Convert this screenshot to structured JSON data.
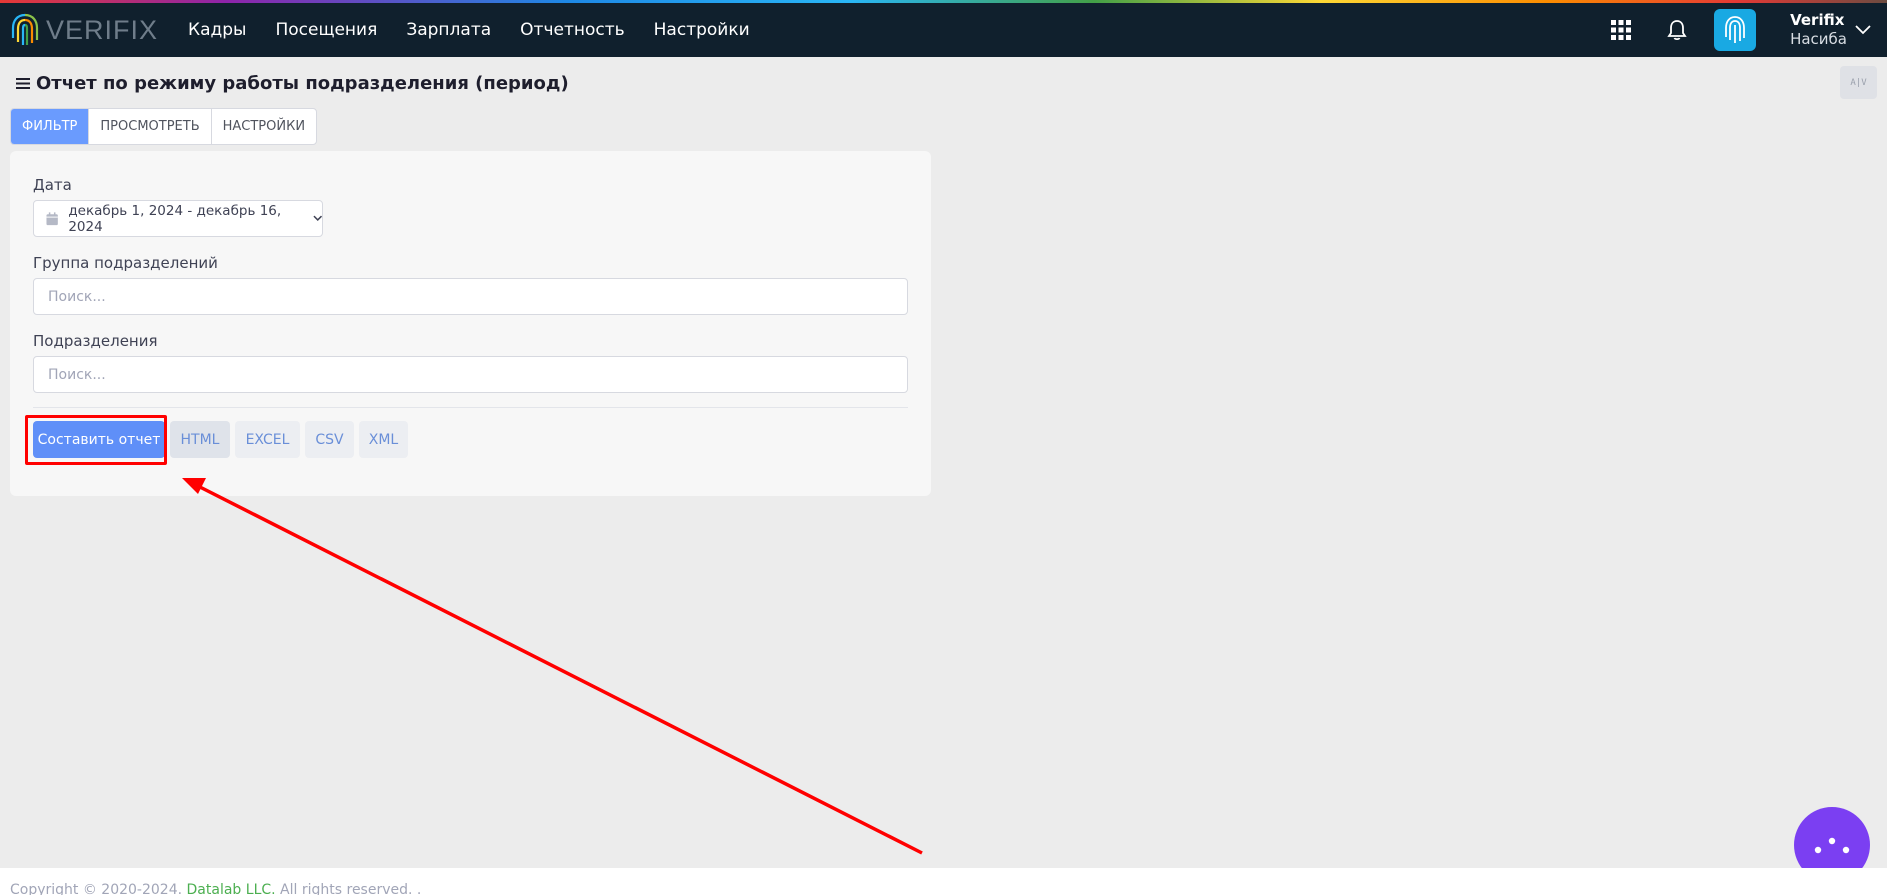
{
  "brand": {
    "name": "VERIFIX"
  },
  "nav": {
    "items": [
      {
        "label": "Кадры"
      },
      {
        "label": "Посещения"
      },
      {
        "label": "Зарплата"
      },
      {
        "label": "Отчетность"
      },
      {
        "label": "Настройки"
      }
    ]
  },
  "user": {
    "name": "Verifix",
    "sub": "Насиба"
  },
  "page": {
    "title": "Отчет по режиму работы подразделения (период)",
    "corner_button": "A|V"
  },
  "tabs": [
    {
      "label": "ФИЛЬТР",
      "active": true
    },
    {
      "label": "ПРОСМОТРЕТЬ",
      "active": false
    },
    {
      "label": "НАСТРОЙКИ",
      "active": false
    }
  ],
  "form": {
    "date_label": "Дата",
    "date_value": "декабрь 1, 2024 - декабрь 16, 2024",
    "group_label": "Группа подразделений",
    "group_placeholder": "Поиск...",
    "division_label": "Подразделения",
    "division_placeholder": "Поиск..."
  },
  "actions": {
    "build": "Составить отчет",
    "html": "HTML",
    "excel": "EXCEL",
    "csv": "CSV",
    "xml": "XML"
  },
  "footer": {
    "prefix": "Copyright © 2020-2024.",
    "company": "Datalab LLC.",
    "suffix": "All rights reserved. ."
  },
  "colors": {
    "topbar": "#10202d",
    "accent": "#6a9bfe",
    "annotation": "#ff0000",
    "fab": "#7b3ff2"
  }
}
